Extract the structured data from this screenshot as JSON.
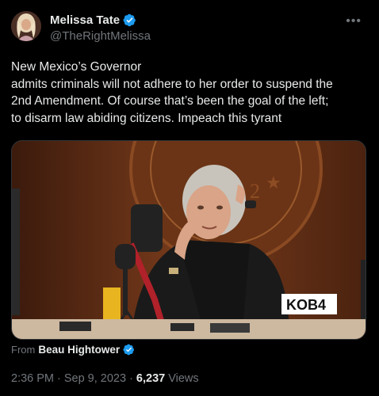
{
  "author": {
    "display_name": "Melissa Tate",
    "handle": "@TheRightMelissa",
    "verified": true
  },
  "tweet": {
    "lines": [
      "New Mexico’s Governor",
      "admits criminals will not adhere to her order to suspend the",
      "2nd Amendment. Of course that’s been the goal of the left;",
      "to disarm law abiding citizens. Impeach this tyrant"
    ]
  },
  "media": {
    "type": "video",
    "watermark": "KOB4"
  },
  "attribution": {
    "from_label": "From",
    "source_name": "Beau Hightower",
    "verified": true
  },
  "meta": {
    "time": "2:36 PM",
    "date": "Sep 9, 2023",
    "views_count": "6,237",
    "views_label": "Views"
  },
  "colors": {
    "background": "#000000",
    "text_primary": "#e7e9ea",
    "text_secondary": "#71767b",
    "verified_blue": "#1d9bf0"
  },
  "icons": {
    "verified": "verified-badge-icon",
    "more": "more-dots-icon"
  }
}
